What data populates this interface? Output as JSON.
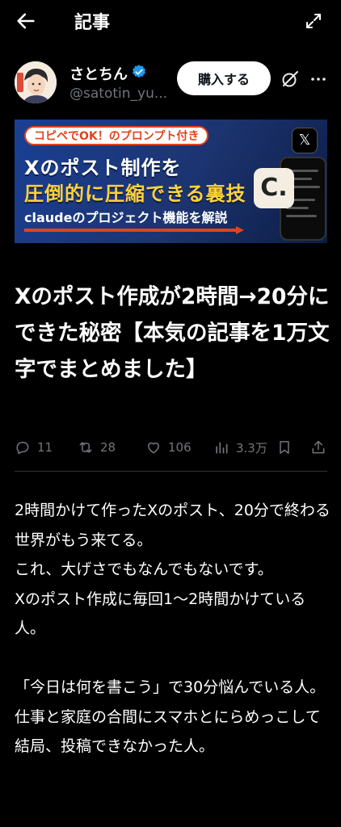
{
  "header": {
    "title": "記事"
  },
  "author": {
    "name": "さとちん",
    "handle": "@satotin_yu...",
    "buy_label": "購入する",
    "avatar_text": "さとちん"
  },
  "banner": {
    "tag": "コピペでOK！のプロンプト付き",
    "line1": "Xのポスト制作を",
    "line2": "圧倒的に圧縮できる裏技",
    "line3": "claudeのプロジェクト機能を解説",
    "x_logo": "𝕏",
    "c_logo": "C."
  },
  "article": {
    "title": "Xのポスト作成が2時間→20分にできた秘密【本気の記事を1万文字でまとめました】",
    "stats": {
      "replies": "11",
      "reposts": "28",
      "likes": "106",
      "views": "3.3万"
    },
    "paragraphs": [
      "2時間かけて作ったXのポスト、20分で終わる世界がもう来てる。\nこれ、大げさでもなんでもないです。\nXのポスト作成に毎回1〜2時間かけている人。",
      "「今日は何を書こう」で30分悩んでいる人。\n仕事と家庭の合間にスマホとにらめっこして\n結局、投稿できなかった人。"
    ]
  },
  "colors": {
    "background": "#000000",
    "muted": "#71767b",
    "accent": "#1d9bf0",
    "banner_yellow": "#ffd23a",
    "banner_orange": "#e0441c"
  },
  "icons": [
    "back-arrow-icon",
    "expand-icon",
    "verified-badge-icon",
    "grok-icon",
    "more-icon",
    "reply-icon",
    "repost-icon",
    "like-icon",
    "views-icon",
    "bookmark-icon",
    "share-icon"
  ]
}
